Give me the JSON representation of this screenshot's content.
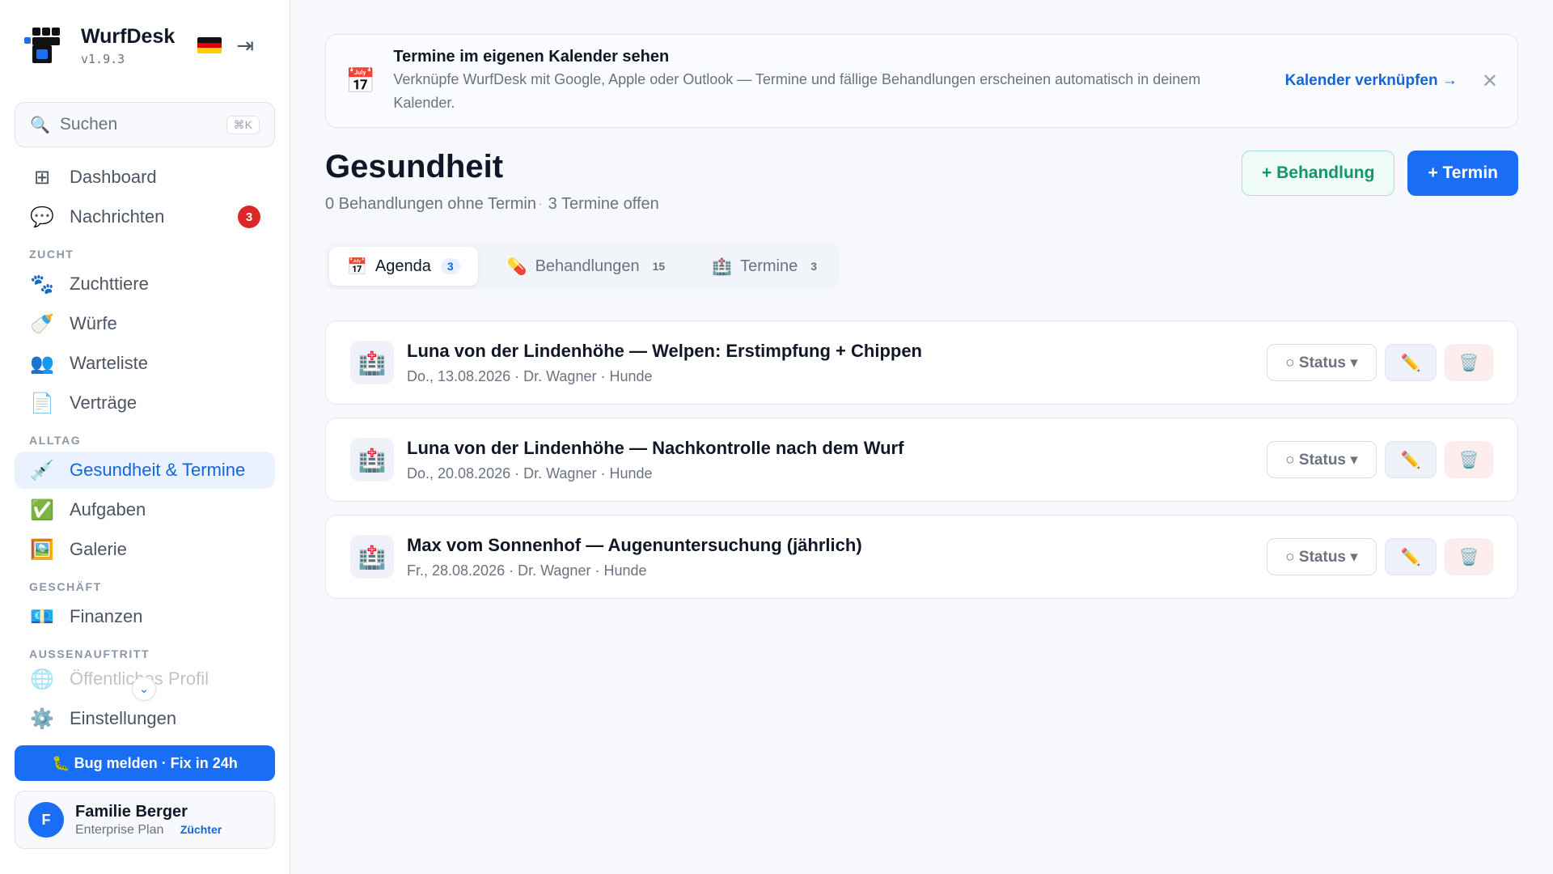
{
  "brand": {
    "name": "WurfDesk",
    "version": "v1.9.3"
  },
  "search": {
    "placeholder": "Suchen",
    "shortcut": "⌘K"
  },
  "sidebar": {
    "top": [
      {
        "label": "Dashboard",
        "icon": "⊞"
      },
      {
        "label": "Nachrichten",
        "icon": "💬",
        "badge": "3"
      }
    ],
    "sections": [
      {
        "title": "ZUCHT",
        "items": [
          {
            "label": "Zuchttiere",
            "icon": "🐾"
          },
          {
            "label": "Würfe",
            "icon": "🍼"
          },
          {
            "label": "Warteliste",
            "icon": "👥"
          },
          {
            "label": "Verträge",
            "icon": "📄"
          }
        ]
      },
      {
        "title": "ALLTAG",
        "items": [
          {
            "label": "Gesundheit & Termine",
            "icon": "💉"
          },
          {
            "label": "Aufgaben",
            "icon": "✅"
          },
          {
            "label": "Galerie",
            "icon": "🖼️"
          }
        ]
      },
      {
        "title": "GESCHÄFT",
        "items": [
          {
            "label": "Finanzen",
            "icon": "💶"
          }
        ]
      },
      {
        "title": "AUSSENAUFTRITT",
        "items": [
          {
            "label": "Öffentliches Profil",
            "icon": "🌐"
          }
        ]
      }
    ],
    "settings": {
      "label": "Einstellungen",
      "icon": "⚙️"
    },
    "bug_button": "🐛 Bug melden · Fix in 24h",
    "user": {
      "initial": "F",
      "name": "Familie Berger",
      "plan": "Enterprise Plan",
      "role": "Züchter"
    }
  },
  "banner": {
    "icon": "📅",
    "title": "Termine im eigenen Kalender sehen",
    "text": "Verknüpfe WurfDesk mit Google, Apple oder Outlook — Termine und fällige Behandlungen erscheinen automatisch in deinem Kalender.",
    "link": "Kalender verknüpfen →",
    "close": "✕"
  },
  "page": {
    "title": "Gesundheit",
    "sub_a": "0 Behandlungen ohne Termin",
    "sub_sep": "·",
    "sub_b": "3 Termine offen",
    "btn_treatment": "+ Behandlung",
    "btn_appointment": "+ Termin"
  },
  "tabs": [
    {
      "icon": "📅",
      "label": "Agenda",
      "count": "3"
    },
    {
      "icon": "💊",
      "label": "Behandlungen",
      "count": "15"
    },
    {
      "icon": "🏥",
      "label": "Termine",
      "count": "3"
    }
  ],
  "appointments": [
    {
      "icon": "🏥",
      "title": "Luna von der Lindenhöhe — Welpen: Erstimpfung + Chippen",
      "meta": "Do., 13.08.2026 · Dr. Wagner · Hunde"
    },
    {
      "icon": "🏥",
      "title": "Luna von der Lindenhöhe — Nachkontrolle nach dem Wurf",
      "meta": "Do., 20.08.2026 · Dr. Wagner · Hunde"
    },
    {
      "icon": "🏥",
      "title": "Max vom Sonnenhof — Augenuntersuchung (jährlich)",
      "meta": "Fr., 28.08.2026 · Dr. Wagner · Hunde"
    }
  ],
  "row_actions": {
    "status": "○ Status ▾",
    "edit_icon": "✏️",
    "delete_icon": "🗑️"
  },
  "colors": {
    "accent": "#1a6ef5",
    "active_bg": "#eaf2ff",
    "badge": "#dc2626",
    "success": "#10976b"
  }
}
